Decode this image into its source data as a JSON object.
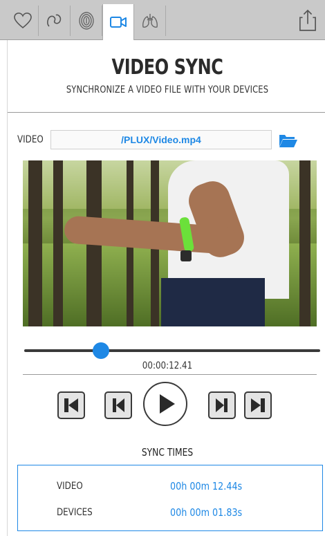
{
  "tabs": [
    {
      "name": "heart-icon",
      "active": false
    },
    {
      "name": "body-icon",
      "active": false
    },
    {
      "name": "fingerprint-icon",
      "active": false
    },
    {
      "name": "video-camera-icon",
      "active": true
    },
    {
      "name": "lungs-icon",
      "active": false
    }
  ],
  "share_icon": "share-icon",
  "header": {
    "title": "VIDEO SYNC",
    "subtitle": "SYNCHRONIZE A VIDEO FILE WITH YOUR DEVICES"
  },
  "file": {
    "label": "VIDEO",
    "path": "/PLUX/Video.mp4",
    "browse_icon": "folder-open-icon"
  },
  "player": {
    "position_fraction": 0.26,
    "time": "00:00:12.41",
    "controls": [
      "skip-to-start-icon",
      "step-back-icon",
      "play-icon",
      "step-forward-icon",
      "skip-to-end-icon"
    ]
  },
  "sync": {
    "title": "SYNC TIMES",
    "rows": [
      {
        "label": "VIDEO",
        "value": "00h 00m 12.44s"
      },
      {
        "label": "DEVICES",
        "value": "00h 00m 01.83s"
      }
    ]
  },
  "colors": {
    "accent": "#1e88e5",
    "tabbar": "#c9c9c9"
  }
}
